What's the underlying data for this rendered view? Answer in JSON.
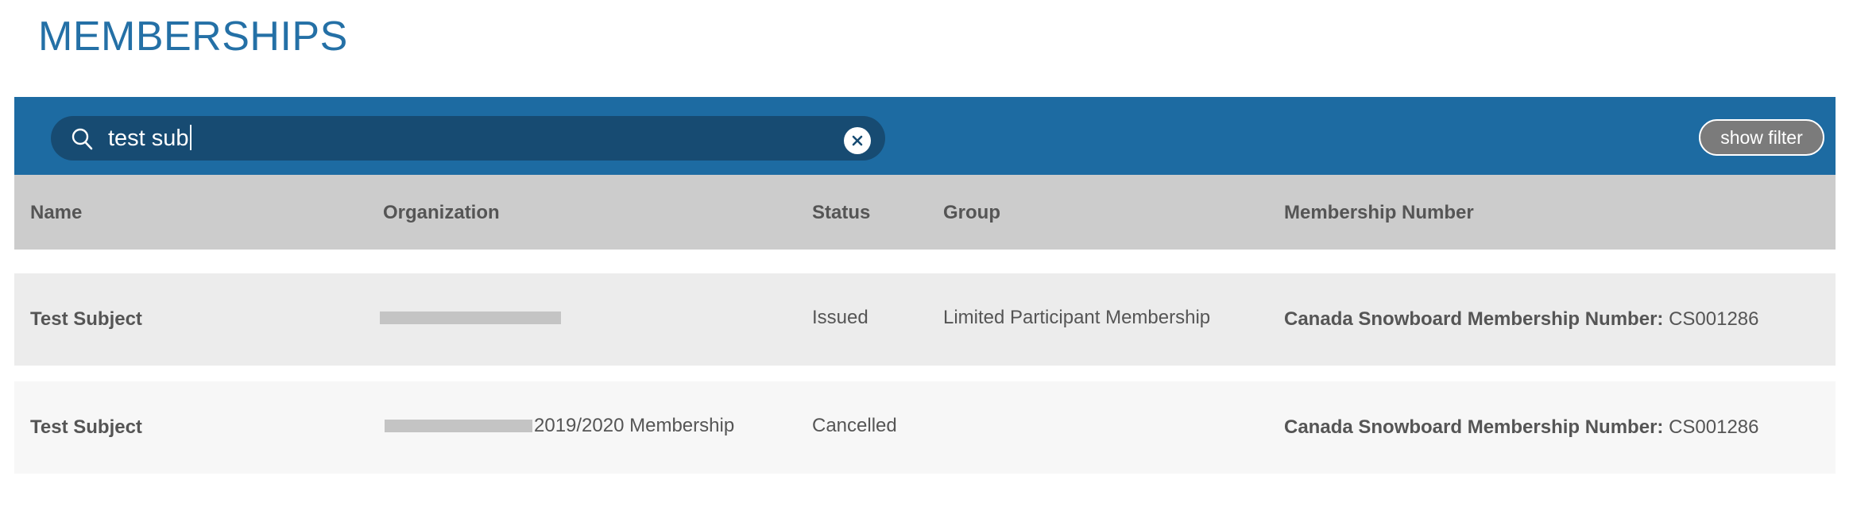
{
  "page": {
    "title": "MEMBERSHIPS"
  },
  "search": {
    "value": "test sub",
    "clear_icon": "close-icon",
    "search_icon": "search-icon"
  },
  "toolbar": {
    "show_filter_label": "show filter"
  },
  "colors": {
    "title": "#2470a6",
    "toolbar_bg": "#1d6ba2",
    "search_bg": "#174b72",
    "header_bg": "#cccccc",
    "filter_button_bg": "#7b7b7b"
  },
  "table": {
    "columns": [
      "Name",
      "Organization",
      "Status",
      "Group",
      "Membership Number"
    ],
    "rows": [
      {
        "name": "Test Subject",
        "organization": "",
        "status": "Issued",
        "group": "Limited Participant Membership",
        "number_label": "Canada Snowboard Membership Number:",
        "number_value": " CS001286"
      },
      {
        "name": "Test Subject",
        "organization": "2019/2020 Membership",
        "status": "Cancelled",
        "group": "",
        "number_label": "Canada Snowboard Membership Number:",
        "number_value": " CS001286"
      }
    ]
  }
}
